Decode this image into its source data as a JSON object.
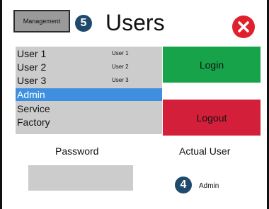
{
  "header": {
    "management_label": "Management",
    "title": "Users",
    "badge_management": "5"
  },
  "user_list": {
    "items": [
      {
        "name": "User 1",
        "tag": "User 1"
      },
      {
        "name": "User 2",
        "tag": "User 2"
      },
      {
        "name": "User 3",
        "tag": "User 3"
      },
      {
        "name": "Admin",
        "tag": ""
      },
      {
        "name": "Service",
        "tag": ""
      },
      {
        "name": "Factory",
        "tag": ""
      }
    ],
    "selected_index": 3
  },
  "actions": {
    "login_label": "Login",
    "logout_label": "Logout"
  },
  "password": {
    "label": "Password",
    "value": ""
  },
  "actual_user": {
    "label": "Actual User",
    "badge": "4",
    "value": "Admin"
  },
  "colors": {
    "login": "#17a34a",
    "logout": "#d31f3a",
    "selected": "#3f8fe0",
    "close": "#e0202c",
    "badge": "#1f4a6b"
  },
  "icons": {
    "close": "close-x-icon"
  }
}
